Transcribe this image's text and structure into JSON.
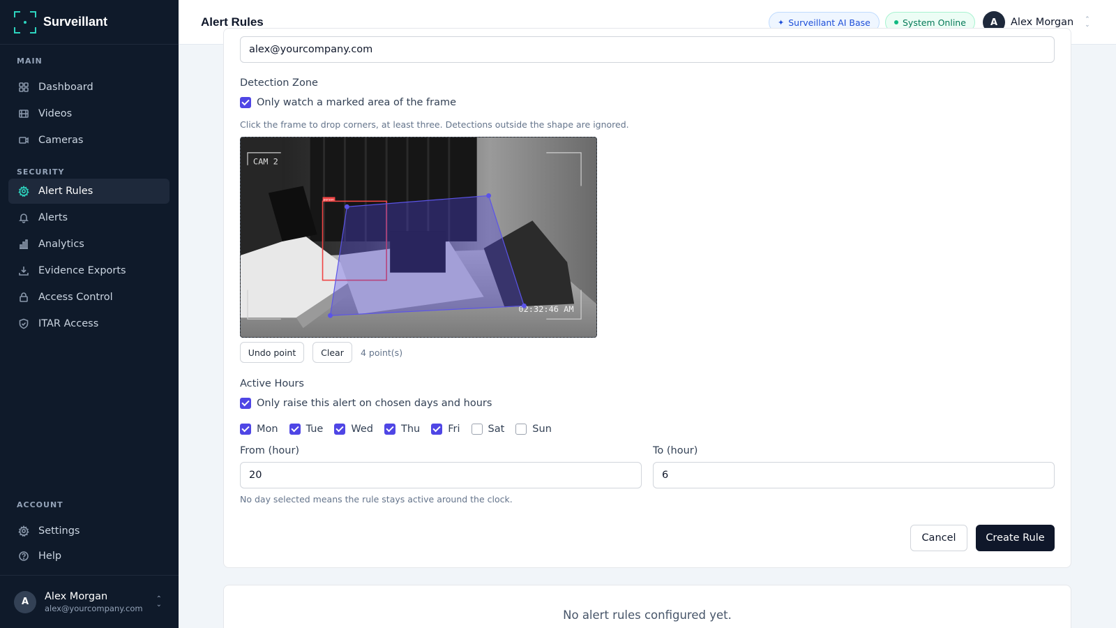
{
  "app": {
    "name": "Surveillant"
  },
  "sidebar": {
    "sections": {
      "main": "MAIN",
      "security": "SECURITY",
      "account": "ACCOUNT"
    },
    "main_items": [
      {
        "label": "Dashboard",
        "icon": "grid-icon"
      },
      {
        "label": "Videos",
        "icon": "film-icon"
      },
      {
        "label": "Cameras",
        "icon": "camera-icon"
      }
    ],
    "security_items": [
      {
        "label": "Alert Rules",
        "icon": "gear-icon",
        "active": true
      },
      {
        "label": "Alerts",
        "icon": "bell-icon"
      },
      {
        "label": "Analytics",
        "icon": "bar-chart-icon"
      },
      {
        "label": "Evidence Exports",
        "icon": "download-icon"
      },
      {
        "label": "Access Control",
        "icon": "lock-icon"
      },
      {
        "label": "ITAR Access",
        "icon": "shield-icon"
      }
    ],
    "account_items": [
      {
        "label": "Settings",
        "icon": "gear-icon"
      },
      {
        "label": "Help",
        "icon": "help-circle-icon"
      }
    ],
    "user": {
      "initial": "A",
      "name": "Alex Morgan",
      "email": "alex@yourcompany.com"
    }
  },
  "header": {
    "title": "Alert Rules",
    "ai_badge": "Surveillant AI Base",
    "status_badge": "System Online",
    "user": {
      "initial": "A",
      "name": "Alex Morgan"
    }
  },
  "form": {
    "email_value": "alex@yourcompany.com",
    "zone": {
      "title": "Detection Zone",
      "checkbox_label": "Only watch a marked area of the frame",
      "checked": true,
      "hint": "Click the frame to drop corners, at least three. Detections outside the shape are ignored.",
      "camera_label": "CAM 2",
      "timestamp": "02:32:46 AM",
      "detection_tag": "person",
      "undo_label": "Undo point",
      "clear_label": "Clear",
      "points_label": "4 point(s)"
    },
    "hours": {
      "title": "Active Hours",
      "checkbox_label": "Only raise this alert on chosen days and hours",
      "checked": true,
      "days": [
        {
          "label": "Mon",
          "checked": true
        },
        {
          "label": "Tue",
          "checked": true
        },
        {
          "label": "Wed",
          "checked": true
        },
        {
          "label": "Thu",
          "checked": true
        },
        {
          "label": "Fri",
          "checked": true
        },
        {
          "label": "Sat",
          "checked": false
        },
        {
          "label": "Sun",
          "checked": false
        }
      ],
      "from_label": "From (hour)",
      "from_value": "20",
      "to_label": "To (hour)",
      "to_value": "6",
      "hint": "No day selected means the rule stays active around the clock."
    },
    "cancel_label": "Cancel",
    "create_label": "Create Rule"
  },
  "rules_list": {
    "empty_message": "No alert rules configured yet."
  },
  "colors": {
    "accent": "#4f46e5",
    "teal": "#2dd4bf",
    "sidebar_bg": "#0f1a2a",
    "primary_button": "#0f172a",
    "detection_box": "#ef4444"
  }
}
